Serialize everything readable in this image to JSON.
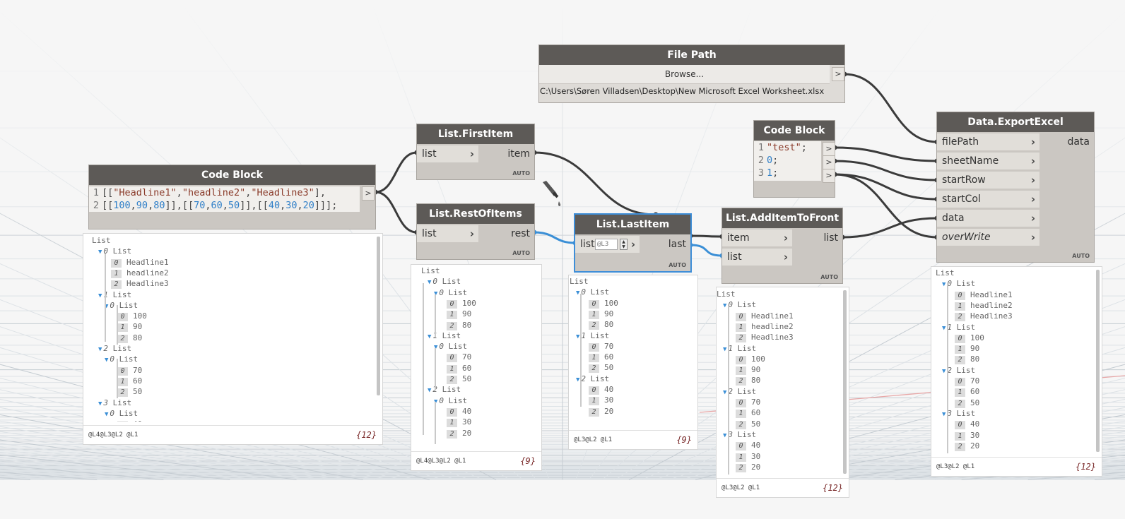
{
  "colors": {
    "node_header": "#5d5a57",
    "node_body": "#cbc7c2",
    "selection": "#3e8ed8",
    "wire": "#3b3b3b",
    "wire_selected": "#3b8fd6",
    "count": "#7a2a2a",
    "number": "#2f7fc8",
    "string": "#8a3b2a"
  },
  "icons": {
    "eyedropper": "eyedropper-icon"
  },
  "file_path": {
    "title": "File Path",
    "browse": "Browse...",
    "path": "C:\\Users\\Søren Villadsen\\Desktop\\New Microsoft Excel Worksheet.xlsx",
    "out": ">"
  },
  "code_block_1": {
    "title": "Code Block",
    "line1_num": "1",
    "line2_num": "2",
    "out": ">",
    "l1_a": "[[",
    "l1_s1": "\"Headline1\"",
    "l1_c1": ",",
    "l1_s2": "\"headline2\"",
    "l1_c2": ",",
    "l1_s3": "\"Headline3\"",
    "l1_e": "],",
    "l2_a": "[[",
    "l2_n1": "100",
    "l2_c1": ",",
    "l2_n2": "90",
    "l2_c2": ",",
    "l2_n3": "80",
    "l2_b": "]],[[",
    "l2_n4": "70",
    "l2_c3": ",",
    "l2_n5": "60",
    "l2_c4": ",",
    "l2_n6": "50",
    "l2_c": "]],[[",
    "l2_n7": "40",
    "l2_c5": ",",
    "l2_n8": "30",
    "l2_c6": ",",
    "l2_n9": "20",
    "l2_e": "]]];"
  },
  "code_block_2": {
    "title": "Code Block",
    "n1": "1",
    "n2": "2",
    "n3": "3",
    "s1": "\"test\"",
    "semi1": ";",
    "v2": "0",
    "semi2": ";",
    "v3": "1",
    "semi3": ";",
    "out": ">"
  },
  "first_item": {
    "title": "List.FirstItem",
    "in1": "list",
    "out1": "item",
    "auto": "AUTO"
  },
  "rest_of_items": {
    "title": "List.RestOfItems",
    "in1": "list",
    "out1": "rest",
    "auto": "AUTO"
  },
  "last_item": {
    "title": "List.LastItem",
    "in1": "list",
    "lacing": "@L3",
    "out1": "last",
    "auto": "AUTO"
  },
  "add_item": {
    "title": "List.AddItemToFront",
    "in1": "item",
    "in2": "list",
    "out1": "list",
    "auto": "AUTO"
  },
  "export": {
    "title": "Data.ExportExcel",
    "inputs": [
      "filePath",
      "sheetName",
      "startRow",
      "startCol",
      "data",
      "overWrite"
    ],
    "out1": "data",
    "auto": "AUTO"
  },
  "previews": {
    "p1": {
      "levels": "@L4@L3@L2 @L1",
      "count": "{12}"
    },
    "p2": {
      "levels": "@L4@L3@L2 @L1",
      "count": "{9}"
    },
    "p3": {
      "levels": "@L3@L2 @L1",
      "count": "{9}"
    },
    "p4": {
      "levels": "@L3@L2 @L1",
      "count": "{12}"
    },
    "p5": {
      "levels": "@L3@L2 @L1",
      "count": "{12}"
    }
  },
  "tree_text": {
    "list": "List",
    "h1": "Headline1",
    "h2": "headline2",
    "h3": "Headline3",
    "v100": "100",
    "v90": "90",
    "v80": "80",
    "v70": "70",
    "v60": "60",
    "v50": "50",
    "v40": "40",
    "v30": "30",
    "v20": "20",
    "i0": "0",
    "i1": "1",
    "i2": "2",
    "i3": "3"
  }
}
